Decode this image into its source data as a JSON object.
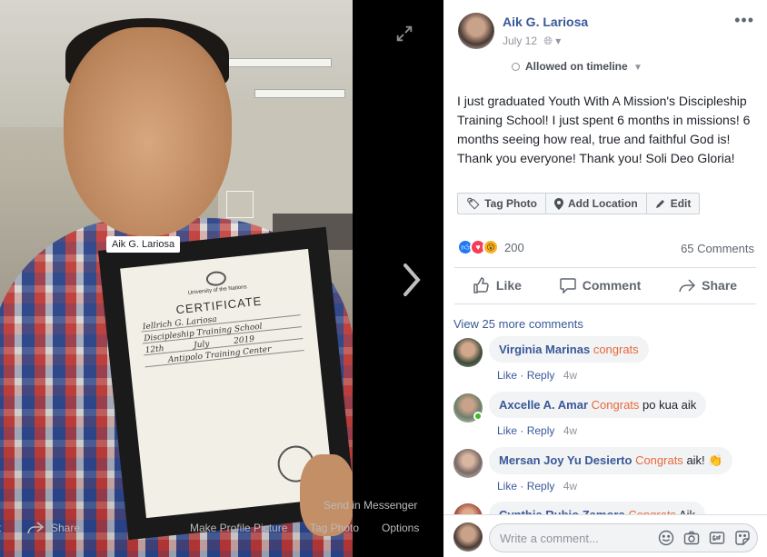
{
  "photo": {
    "tag_label": "Aik G. Lariosa",
    "certificate": {
      "org_line": "University of the Nations",
      "title": "CERTIFICATE",
      "name": "Iellrich G. Lariosa",
      "course": "Discipleship Training School",
      "day": "12th",
      "month": "July",
      "year": "2019",
      "place": "Antipolo Training Center"
    },
    "bottom_bar": {
      "share": "Share",
      "make_profile": "Make Profile Picture",
      "tag_photo": "Tag Photo",
      "options": "Options",
      "send_messenger": "Send in Messenger"
    }
  },
  "post": {
    "author": "Aik G. Lariosa",
    "date": "July 12",
    "allowed": "Allowed on timeline",
    "caption": "I just graduated Youth With A Mission's Discipleship Training School! I just spent 6 months in missions! 6 months seeing how real, true and faithful God is! Thank you everyone! Thank you! Soli Deo Gloria!",
    "tag_actions": [
      "Tag Photo",
      "Add Location",
      "Edit"
    ],
    "reactions_count": "200",
    "comments_count": "65 Comments",
    "actions": [
      "Like",
      "Comment",
      "Share"
    ]
  },
  "comments": {
    "view_more": "View 25 more comments",
    "like_label": "Like",
    "reply_label": "Reply",
    "items": [
      {
        "name": "Virginia Marinas",
        "tag": "congrats",
        "text": "",
        "time": "4w"
      },
      {
        "name": "Axcelle A. Amar",
        "tag": "Congrats",
        "text": "po kua aik",
        "time": "4w"
      },
      {
        "name": "Mersan Joy Yu Desierto",
        "tag": "Congrats",
        "text": "aik! 👏",
        "time": "4w"
      },
      {
        "name": "Cynthia Rubio Zamora",
        "tag": "Congrats",
        "text": "Aik",
        "time": ""
      }
    ]
  },
  "composer": {
    "placeholder": "Write a comment..."
  },
  "colors": {
    "link": "#385898",
    "tag_orange": "#e86a3a",
    "like_blue": "#2078f4",
    "love_red": "#f33e58",
    "wow_yellow": "#f7b125"
  }
}
